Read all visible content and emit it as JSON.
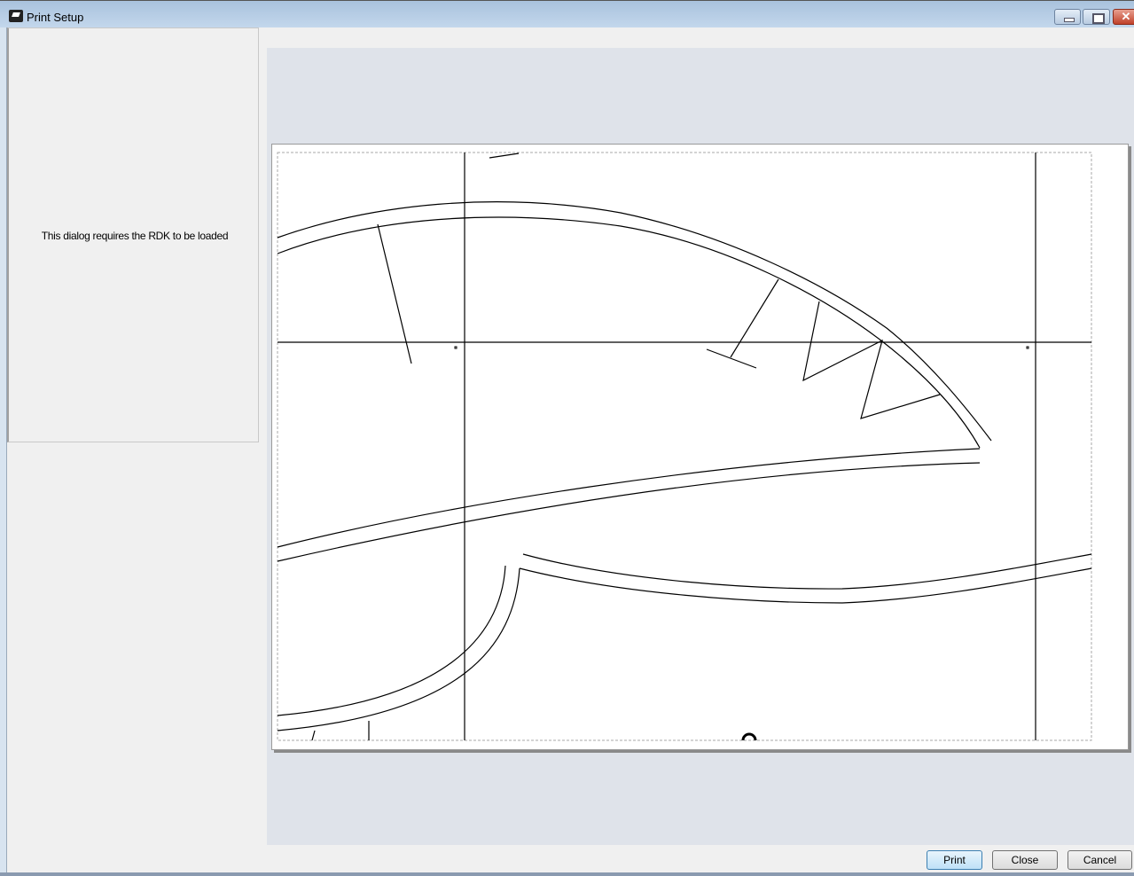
{
  "window": {
    "title": "Print Setup"
  },
  "left_panel": {
    "message": "This dialog requires the RDK to be loaded"
  },
  "buttons": {
    "print": "Print",
    "close": "Close",
    "cancel": "Cancel",
    "window_close": "✕"
  }
}
